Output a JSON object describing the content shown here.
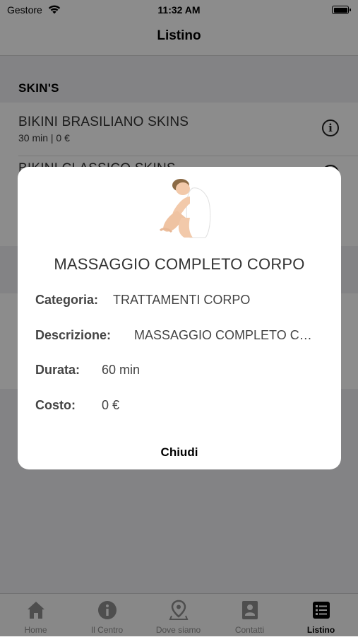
{
  "status_bar": {
    "carrier": "Gestore",
    "time": "11:32 AM"
  },
  "nav": {
    "title": "Listino"
  },
  "section": {
    "title": "SKIN'S"
  },
  "list": [
    {
      "name": "BIKINI BRASILIANO SKINS",
      "details": "30 min | 0 €"
    },
    {
      "name": "BIKINI CLASSICO SKINS",
      "details": ""
    }
  ],
  "dialog": {
    "title": "MASSAGGIO COMPLETO CORPO",
    "image_icon": "massage-woman-photo",
    "category_label": "Categoria:",
    "category_value": "TRATTAMENTI CORPO",
    "description_label": "Descrizione:",
    "description_value": "MASSAGGIO COMPLETO CORPO",
    "duration_label": "Durata:",
    "duration_value": "60 min",
    "cost_label": "Costo:",
    "cost_value": "0 €",
    "close_label": "Chiudi"
  },
  "tabbar": {
    "active": "Listino",
    "tabs": [
      {
        "label": "Home",
        "icon": "home-icon"
      },
      {
        "label": "Il Centro",
        "icon": "info-icon"
      },
      {
        "label": "Dove siamo",
        "icon": "map-pin-icon"
      },
      {
        "label": "Contatti",
        "icon": "contact-card-icon"
      },
      {
        "label": "Listino",
        "icon": "list-icon"
      }
    ]
  },
  "colors": {
    "overlay": "#000000",
    "section_background": "#efeff3",
    "inactive_tab": "#8e8e8e"
  }
}
